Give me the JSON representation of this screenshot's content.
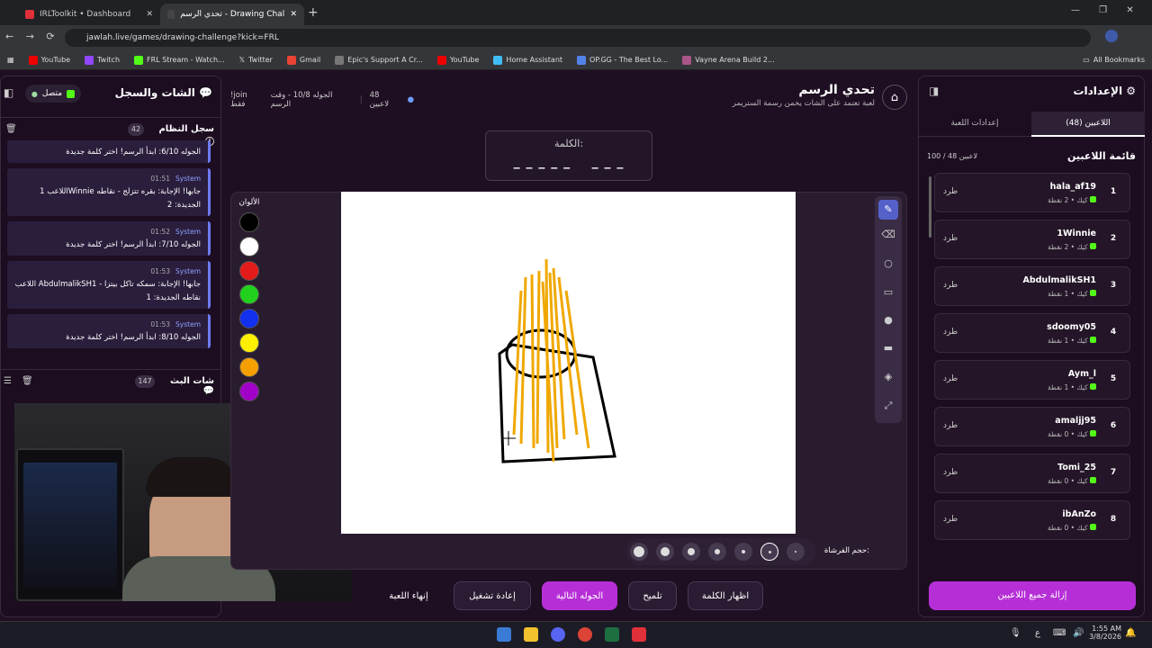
{
  "browser": {
    "tabs": [
      {
        "title": "IRLToolkit • Dashboard"
      },
      {
        "title": "تحدي الرسم - Drawing Challenge"
      }
    ],
    "url": "jawlah.live/games/drawing-challenge?kick=FRL",
    "bookmarks": [
      "YouTube",
      "Twitch",
      "FRL Stream - Watch...",
      "Twitter",
      "Gmail",
      "Epic's Support A Cr...",
      "YouTube",
      "Home Assistant",
      "OP.GG - The Best Lo...",
      "Vayne Arena Build 2..."
    ],
    "all_bookmarks": "All Bookmarks"
  },
  "left": {
    "title": "الشات والسجل",
    "status": "متصل",
    "syslog_title": "سجل النظام",
    "syslog_count": "42",
    "first_line": "الجوله 6/10: ابدأ الرسم! اختر كلمة جديدة",
    "messages": [
      {
        "time": "01:51",
        "sender": "System",
        "text": "اللاعب 1Winnie جابها! الإجابة: بقره تتزلج - نقاطه الجديدة: 2"
      },
      {
        "time": "01:52",
        "sender": "System",
        "text": "الجوله 7/10: ابدأ الرسم! اختر كلمة جديدة"
      },
      {
        "time": "01:53",
        "sender": "System",
        "text": "اللاعب AbdulmalikSH1 جابها! الإجابة: سمكه تاكل بيتزا - نقاطه الجديدة: 1"
      },
      {
        "time": "01:53",
        "sender": "System",
        "text": "الجوله 8/10: ابدأ الرسم! اختر كلمة جديدة"
      }
    ],
    "chat_title": "شات البث",
    "chat_count": "147"
  },
  "game": {
    "title": "تحدي الرسم",
    "subtitle": "لعبة تعتمد على الشات يخمن رسمة الستريمر",
    "players_count": "48 لاعبين",
    "round_info": "الجوله 10/8 - وقت الرسم",
    "join_hint": "!join فقط",
    "word_label": "الكلمة:",
    "word_mask": "_ _ _ _ _    _ _ _",
    "colors_label": "الألوان",
    "colors": [
      "#000000",
      "#ffffff",
      "#e31b1b",
      "#22d11d",
      "#1230f0",
      "#ffef00",
      "#f5a000",
      "#a000c8"
    ],
    "brush_label": "حجم الفرشاة:",
    "buttons": {
      "show_word": "اظهار الكلمة",
      "hint": "تلميح",
      "next_round": "الجوله التالية",
      "restart": "إعادة تشغيل",
      "end": "إنهاء اللعبة"
    }
  },
  "right": {
    "title": "الإعدادات",
    "tab_players": "اللاعبين (48)",
    "tab_settings": "إعدادات اللعبة",
    "list_title": "قائمة اللاعبين",
    "list_count": "100 / 48 لاعبين",
    "kick_label": "طرد",
    "players": [
      {
        "rank": "1",
        "name": "hala_af19",
        "meta": "كيك • 2 نقطة"
      },
      {
        "rank": "2",
        "name": "1Winnie",
        "meta": "كيك • 2 نقطة"
      },
      {
        "rank": "3",
        "name": "AbdulmalikSH1",
        "meta": "كيك • 1 نقطة"
      },
      {
        "rank": "4",
        "name": "sdoomy05",
        "meta": "كيك • 1 نقطة"
      },
      {
        "rank": "5",
        "name": "Aym_l",
        "meta": "كيك • 1 نقطة"
      },
      {
        "rank": "6",
        "name": "amaljj95",
        "meta": "كيك • 0 نقطة"
      },
      {
        "rank": "7",
        "name": "Tomi_25",
        "meta": "كيك • 0 نقطة"
      },
      {
        "rank": "8",
        "name": "ibAnZo",
        "meta": "كيك • 0 نقطة"
      }
    ],
    "remove_all": "إزالة جميع اللاعبين"
  },
  "taskbar": {
    "time": "1:55 AM",
    "date": "3/8/2026",
    "lang": "ع"
  }
}
